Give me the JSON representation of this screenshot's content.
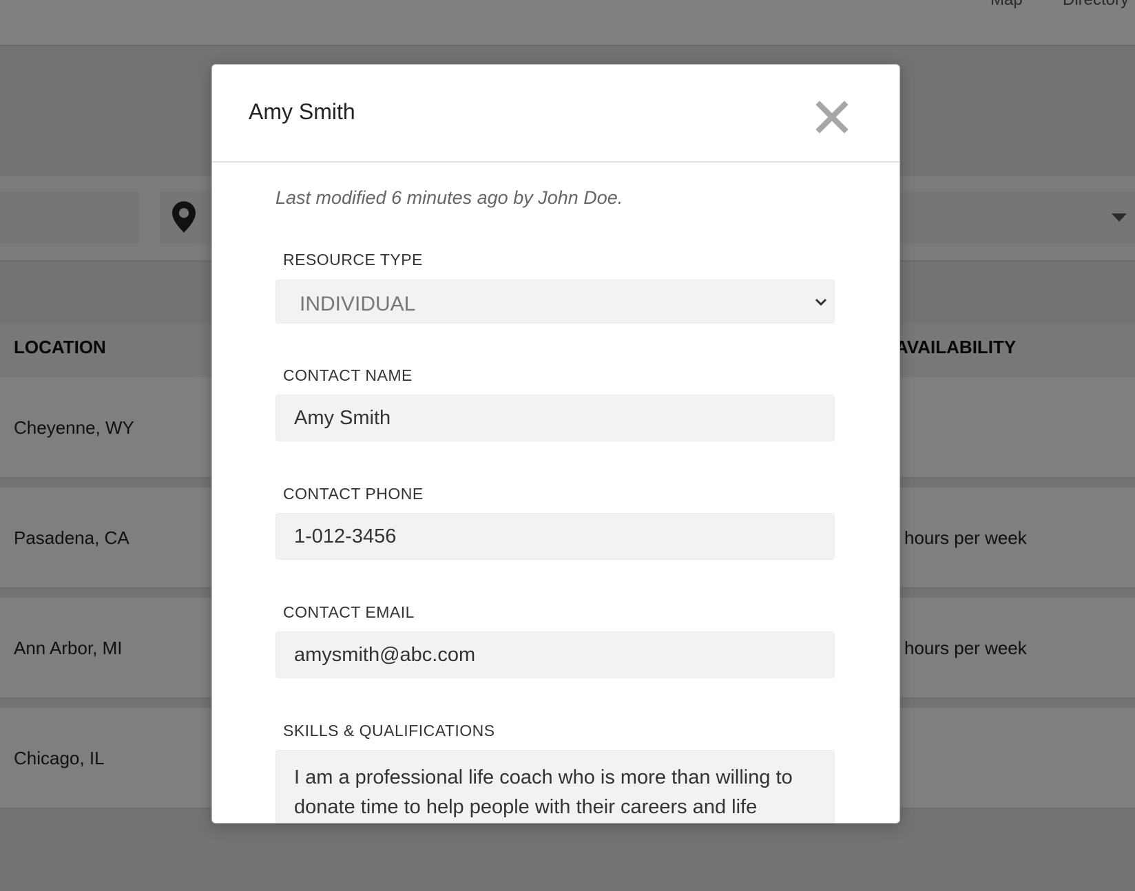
{
  "background": {
    "nav": [
      "Map",
      "Directory"
    ],
    "table": {
      "headers": [
        "LOCATION",
        "AVAILABILITY"
      ],
      "rows": [
        {
          "location": "Cheyenne, WY",
          "availability": ""
        },
        {
          "location": "Pasadena, CA",
          "availability": "hours per week"
        },
        {
          "location": "Ann Arbor, MI",
          "availability": "hours per week"
        },
        {
          "location": "Chicago, IL",
          "availability": ""
        }
      ]
    }
  },
  "modal": {
    "title": "Amy Smith",
    "last_modified": "Last modified 6 minutes ago by John Doe.",
    "fields": {
      "resource_type": {
        "label": "RESOURCE TYPE",
        "value": "INDIVIDUAL"
      },
      "contact_name": {
        "label": "CONTACT NAME",
        "value": "Amy Smith"
      },
      "contact_phone": {
        "label": "CONTACT PHONE",
        "value": "1-012-3456"
      },
      "contact_email": {
        "label": "CONTACT EMAIL",
        "value": "amysmith@abc.com"
      },
      "skills": {
        "label": "SKILLS & QUALIFICATIONS",
        "value": "I am a professional life coach who is more than willing to donate time to help people with their careers and life"
      }
    }
  },
  "icons": {
    "close": "close-icon",
    "location": "location-pin-icon",
    "select": "chevron-down-icon",
    "dropdown": "caret-down-icon"
  }
}
